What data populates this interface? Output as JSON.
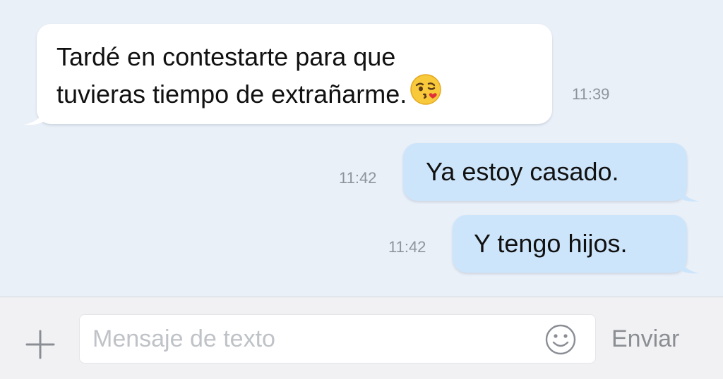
{
  "messages": [
    {
      "direction": "incoming",
      "lines": [
        "Tardé en contestarte para que",
        "tuvieras tiempo de extrañarme."
      ],
      "emoji": "kissing-face-with-heart-icon",
      "time": "11:39"
    },
    {
      "direction": "outgoing",
      "text": "Ya estoy casado.",
      "time": "11:42"
    },
    {
      "direction": "outgoing",
      "text": "Y tengo hijos.",
      "time": "11:42"
    }
  ],
  "input_bar": {
    "add_icon": "plus-icon",
    "placeholder": "Mensaje de texto",
    "value": "",
    "emoji_icon": "smiley-icon",
    "send_label": "Enviar"
  },
  "colors": {
    "chat_background": "#eaf0f8",
    "incoming_bubble": "#ffffff",
    "outgoing_bubble": "#cde5fb",
    "timestamp": "#8e949c",
    "input_bar_background": "#f1f1f3",
    "send_text": "#8b8e93"
  }
}
